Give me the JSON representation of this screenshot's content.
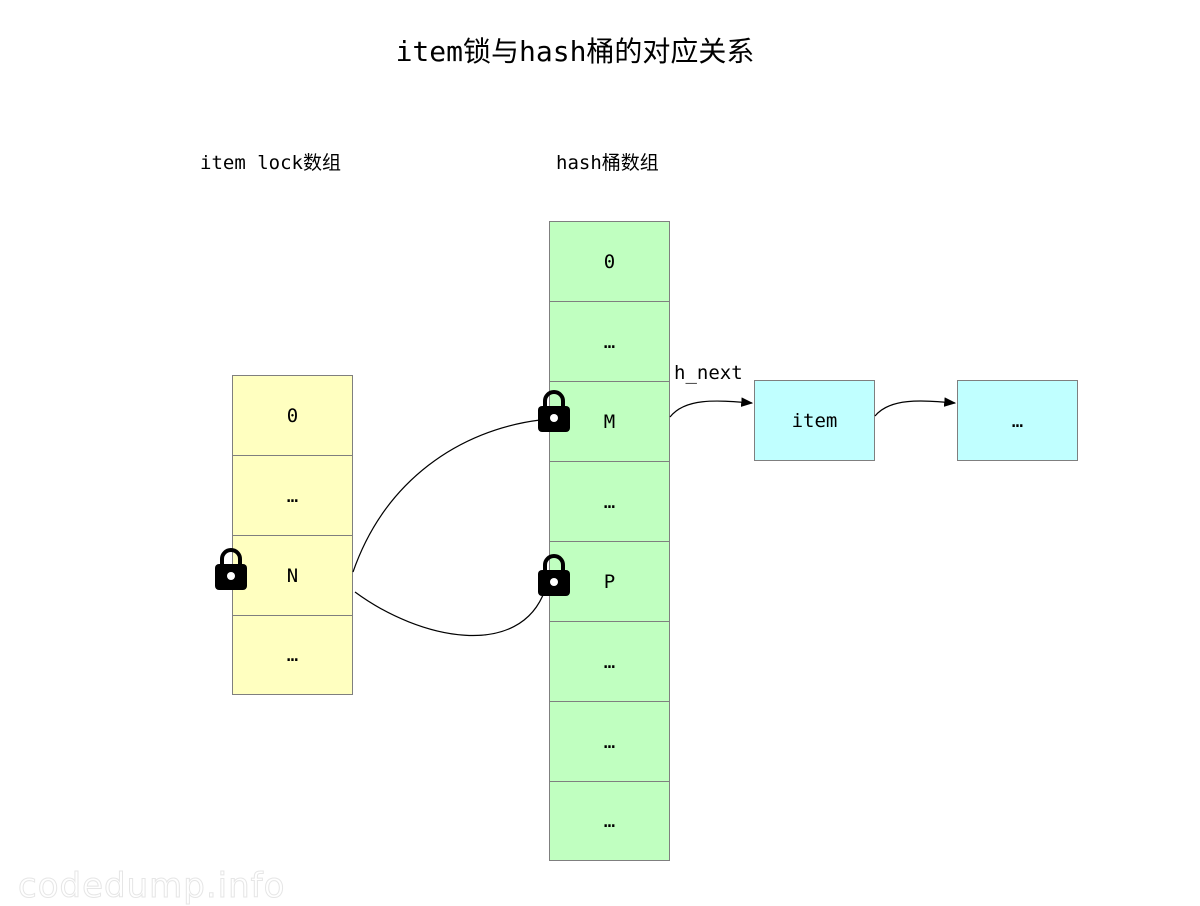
{
  "title": "item锁与hash桶的对应关系",
  "lock_array": {
    "label": "item lock数组",
    "cells": [
      "0",
      "…",
      "N",
      "…"
    ],
    "locked_index": 2,
    "color": "#ffffc0"
  },
  "hash_array": {
    "label": "hash桶数组",
    "cells": [
      "0",
      "…",
      "M",
      "…",
      "P",
      "…",
      "…",
      "…"
    ],
    "locked_indices": [
      2,
      4
    ],
    "color": "#c0ffc0"
  },
  "chain": {
    "edge_label": "h_next",
    "nodes": [
      "item",
      "…"
    ],
    "color": "#c0ffff"
  },
  "edges": [
    {
      "from": "lock N",
      "to": "bucket M"
    },
    {
      "from": "lock N",
      "to": "bucket P"
    },
    {
      "from": "bucket M",
      "to": "item",
      "label": "h_next",
      "arrow": true
    },
    {
      "from": "item",
      "to": "…",
      "arrow": true
    }
  ],
  "watermark": "codedump.info"
}
